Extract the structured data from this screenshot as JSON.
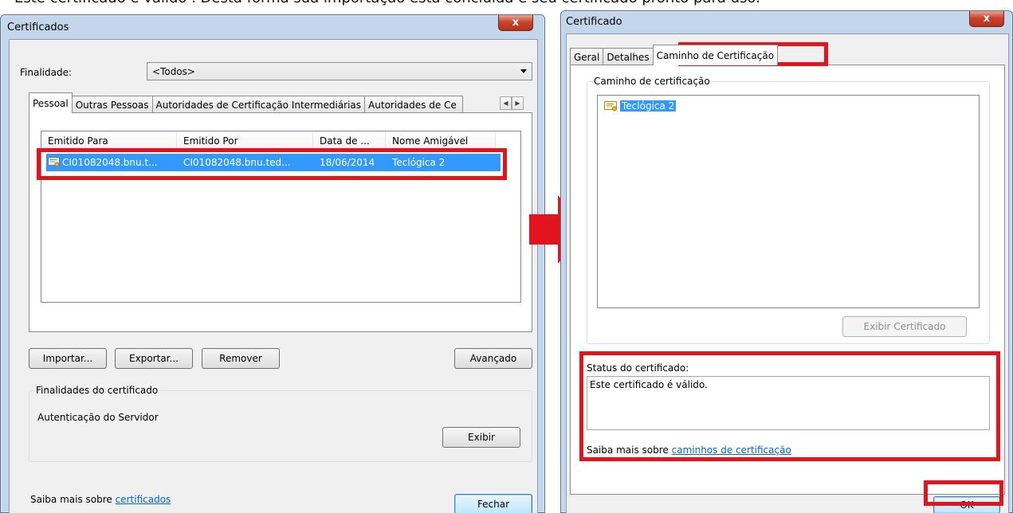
{
  "caption": "Este certificado é válido . Desta forma sua importação está concluída e seu certificado pronto para uso.",
  "left_window": {
    "title": "Certificados",
    "close_glyph": "x",
    "purpose_label": "Finalidade:",
    "purpose_value": "<Todos>",
    "tabs": [
      "Pessoal",
      "Outras Pessoas",
      "Autoridades de Certificação Intermediárias",
      "Autoridades de Ce"
    ],
    "columns": [
      "Emitido Para",
      "Emitido Por",
      "Data de ...",
      "Nome Amigável"
    ],
    "row": {
      "issued_to": "CI01082048.bnu.t...",
      "issued_by": "CI01082048.bnu.ted...",
      "date": "18/06/2014",
      "friendly_name": "Teclógica 2"
    },
    "buttons": {
      "import": "Importar...",
      "export": "Exportar...",
      "remove": "Remover",
      "advanced": "Avançado",
      "view": "Exibir",
      "close": "Fechar"
    },
    "purposes_group_label": "Finalidades do certificado",
    "purposes_value": "Autenticação do Servidor",
    "learn_more_prefix": "Saiba mais sobre ",
    "learn_more_link": "certificados"
  },
  "right_window": {
    "title": "Certificado",
    "close_glyph": "x",
    "tabs": [
      "Geral",
      "Detalhes",
      "Caminho de Certificação"
    ],
    "path_group_label": "Caminho de certificação",
    "path_item": "Teclógica 2",
    "view_cert_button": "Exibir Certificado",
    "status_label": "Status do certificado:",
    "status_text": "Este certificado é válido.",
    "learn_more_prefix": "Saiba mais sobre ",
    "learn_more_link": "caminhos de certificação",
    "ok_button": "OK"
  },
  "colors": {
    "highlight_red": "#e3141c",
    "selection_blue": "#3399ff",
    "link_blue": "#0066cc"
  },
  "icons": [
    "certificate-icon",
    "close-icon",
    "chevron-down-icon",
    "scroll-left-icon",
    "scroll-right-icon",
    "right-arrow-icon"
  ]
}
